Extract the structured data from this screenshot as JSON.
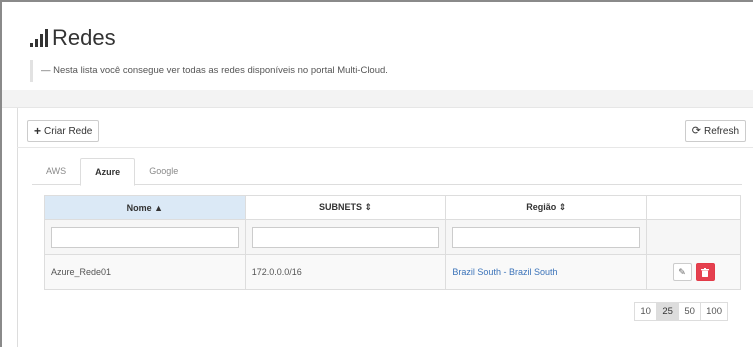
{
  "header": {
    "title": "Redes",
    "subtitle": "— Nesta lista você consegue ver todas as redes disponíveis no portal Multi-Cloud."
  },
  "toolbar": {
    "create_label": "Criar Rede",
    "refresh_label": "Refresh",
    "create_icon": "plus-icon",
    "refresh_icon": "refresh-icon"
  },
  "tabs": [
    {
      "label": "AWS",
      "active": false
    },
    {
      "label": "Azure",
      "active": true
    },
    {
      "label": "Google",
      "active": false
    }
  ],
  "table": {
    "columns": [
      {
        "label": "Nome ▲",
        "sorted": true
      },
      {
        "label": "SUBNETS ⇕",
        "sorted": false
      },
      {
        "label": "Região ⇕",
        "sorted": false
      },
      {
        "label": "",
        "sorted": false
      }
    ],
    "filters": {
      "nome": "",
      "subnets": "",
      "regiao": ""
    },
    "rows": [
      {
        "nome": "Azure_Rede01",
        "subnets": "172.0.0.0/16",
        "regiao": "Brazil South - Brazil South"
      }
    ]
  },
  "pagination": {
    "options": [
      "10",
      "25",
      "50",
      "100"
    ],
    "selected": "25"
  },
  "colors": {
    "accent_link": "#3b73b9",
    "delete_red": "#e5404f",
    "sorted_header": "#dbe9f6"
  }
}
